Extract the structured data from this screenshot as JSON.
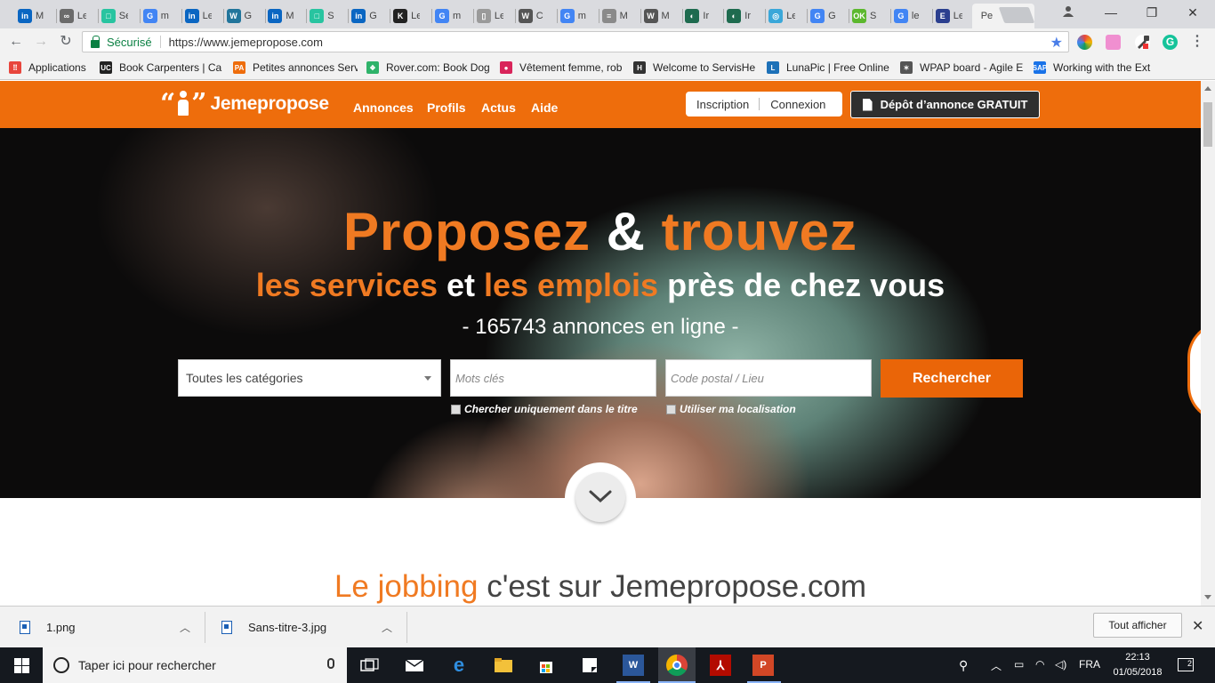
{
  "browser": {
    "tabs": [
      {
        "label": "M",
        "icon": "linkedin-icon",
        "color": "#0a66c2",
        "glyph": "in"
      },
      {
        "label": "Le",
        "icon": "link-icon",
        "color": "#6b6b6b",
        "glyph": "∞"
      },
      {
        "label": "Se",
        "icon": "square-icon",
        "color": "#28c4a0",
        "glyph": "□"
      },
      {
        "label": "m",
        "icon": "google-icon",
        "color": "#4285f4",
        "glyph": "G"
      },
      {
        "label": "Le",
        "icon": "linkedin-icon",
        "color": "#0a66c2",
        "glyph": "in"
      },
      {
        "label": "G",
        "icon": "wordpress-icon",
        "color": "#21759b",
        "glyph": "W"
      },
      {
        "label": "M",
        "icon": "linkedin-icon",
        "color": "#0a66c2",
        "glyph": "in"
      },
      {
        "label": "S",
        "icon": "square-icon",
        "color": "#28c4a0",
        "glyph": "□"
      },
      {
        "label": "G",
        "icon": "linkedin-icon",
        "color": "#0a66c2",
        "glyph": "in"
      },
      {
        "label": "Le",
        "icon": "k-icon",
        "color": "#222222",
        "glyph": "K"
      },
      {
        "label": "m",
        "icon": "google-icon",
        "color": "#4285f4",
        "glyph": "G"
      },
      {
        "label": "Le",
        "icon": "page-icon",
        "color": "#9a9a9a",
        "glyph": "▯"
      },
      {
        "label": "C",
        "icon": "wikipedia-icon",
        "color": "#555555",
        "glyph": "W"
      },
      {
        "label": "m",
        "icon": "google-icon",
        "color": "#4285f4",
        "glyph": "G"
      },
      {
        "label": "M",
        "icon": "badge-icon",
        "color": "#8a8a8a",
        "glyph": "≡"
      },
      {
        "label": "M",
        "icon": "wikipedia-icon",
        "color": "#555555",
        "glyph": "W"
      },
      {
        "label": "Ir",
        "icon": "leaf-icon",
        "color": "#1e6b4f",
        "glyph": "◐"
      },
      {
        "label": "Ir",
        "icon": "leaf-icon",
        "color": "#1e6b4f",
        "glyph": "◐"
      },
      {
        "label": "Le",
        "icon": "ring-icon",
        "color": "#3aa7d9",
        "glyph": "◎"
      },
      {
        "label": "G",
        "icon": "translate-icon",
        "color": "#4285f4",
        "glyph": "G"
      },
      {
        "label": "S",
        "icon": "ok-icon",
        "color": "#5cb82e",
        "glyph": "OK"
      },
      {
        "label": "le",
        "icon": "google-icon",
        "color": "#4285f4",
        "glyph": "G"
      },
      {
        "label": "Le",
        "icon": "e-icon",
        "color": "#2b3f8f",
        "glyph": "E"
      },
      {
        "label": "Pe",
        "icon": "none",
        "color": "#f2f2f2",
        "glyph": ""
      }
    ],
    "active_tab_close": "✕",
    "address": {
      "secure_label": "Sécurisé",
      "url": "https://www.jemepropose.com"
    },
    "bookmarks": [
      {
        "label": "Applications",
        "icon": "apps-grid-icon",
        "color": "#e8453c",
        "glyph": "⠿"
      },
      {
        "label": "Book Carpenters | Ca",
        "icon": "uc-icon",
        "color": "#222222",
        "glyph": "UC"
      },
      {
        "label": "Petites annonces Serv",
        "icon": "pa-icon",
        "color": "#ee6d0c",
        "glyph": "PA"
      },
      {
        "label": "Rover.com: Book Dog",
        "icon": "paw-icon",
        "color": "#2fb36a",
        "glyph": "❖"
      },
      {
        "label": "Vêtement femme, rob",
        "icon": "bow-icon",
        "color": "#d9245a",
        "glyph": "●"
      },
      {
        "label": "Welcome to ServisHe",
        "icon": "h-icon",
        "color": "#333333",
        "glyph": "H"
      },
      {
        "label": "LunaPic | Free Online",
        "icon": "lunapic-icon",
        "color": "#1d71b8",
        "glyph": "L"
      },
      {
        "label": "WPAP board - Agile E",
        "icon": "star-person-icon",
        "color": "#555555",
        "glyph": "✶"
      },
      {
        "label": "Working with the Ext",
        "icon": "sap-icon",
        "color": "#1a73e8",
        "glyph": "SAP"
      }
    ]
  },
  "site": {
    "logo_text": "Jemepropose",
    "nav": [
      "Annonces",
      "Profils",
      "Actus",
      "Aide"
    ],
    "auth": {
      "signup": "Inscription",
      "login": "Connexion"
    },
    "post_ad": "Dépôt d’annonce GRATUIT",
    "hero": {
      "title_a": "Proposez",
      "title_amp": " & ",
      "title_b": "trouvez",
      "sub_a": "les services",
      "sub_b": " et ",
      "sub_c": "les emplois",
      "sub_d": " près de chez vous",
      "count": "- 165743 annonces en ligne -",
      "category": "Toutes les catégories",
      "keywords_placeholder": "Mots clés",
      "location_placeholder": "Code postal / Lieu",
      "search_button": "Rechercher",
      "check_title": "Chercher uniquement dans le titre",
      "check_location": "Utiliser ma localisation"
    },
    "section_title_a": "Le jobbing",
    "section_title_b": " c'est sur Jemepropose.com"
  },
  "downloads": {
    "items": [
      "1.png",
      "Sans-titre-3.jpg"
    ],
    "show_all": "Tout afficher"
  },
  "taskbar": {
    "search_placeholder": "Taper ici pour rechercher",
    "language": "FRA",
    "time": "22:13",
    "date": "01/05/2018",
    "notification_count": "2"
  },
  "colors": {
    "brand_orange": "#ee6d0c",
    "search_button": "#ea6508",
    "dark_button": "#2f2f2f"
  }
}
